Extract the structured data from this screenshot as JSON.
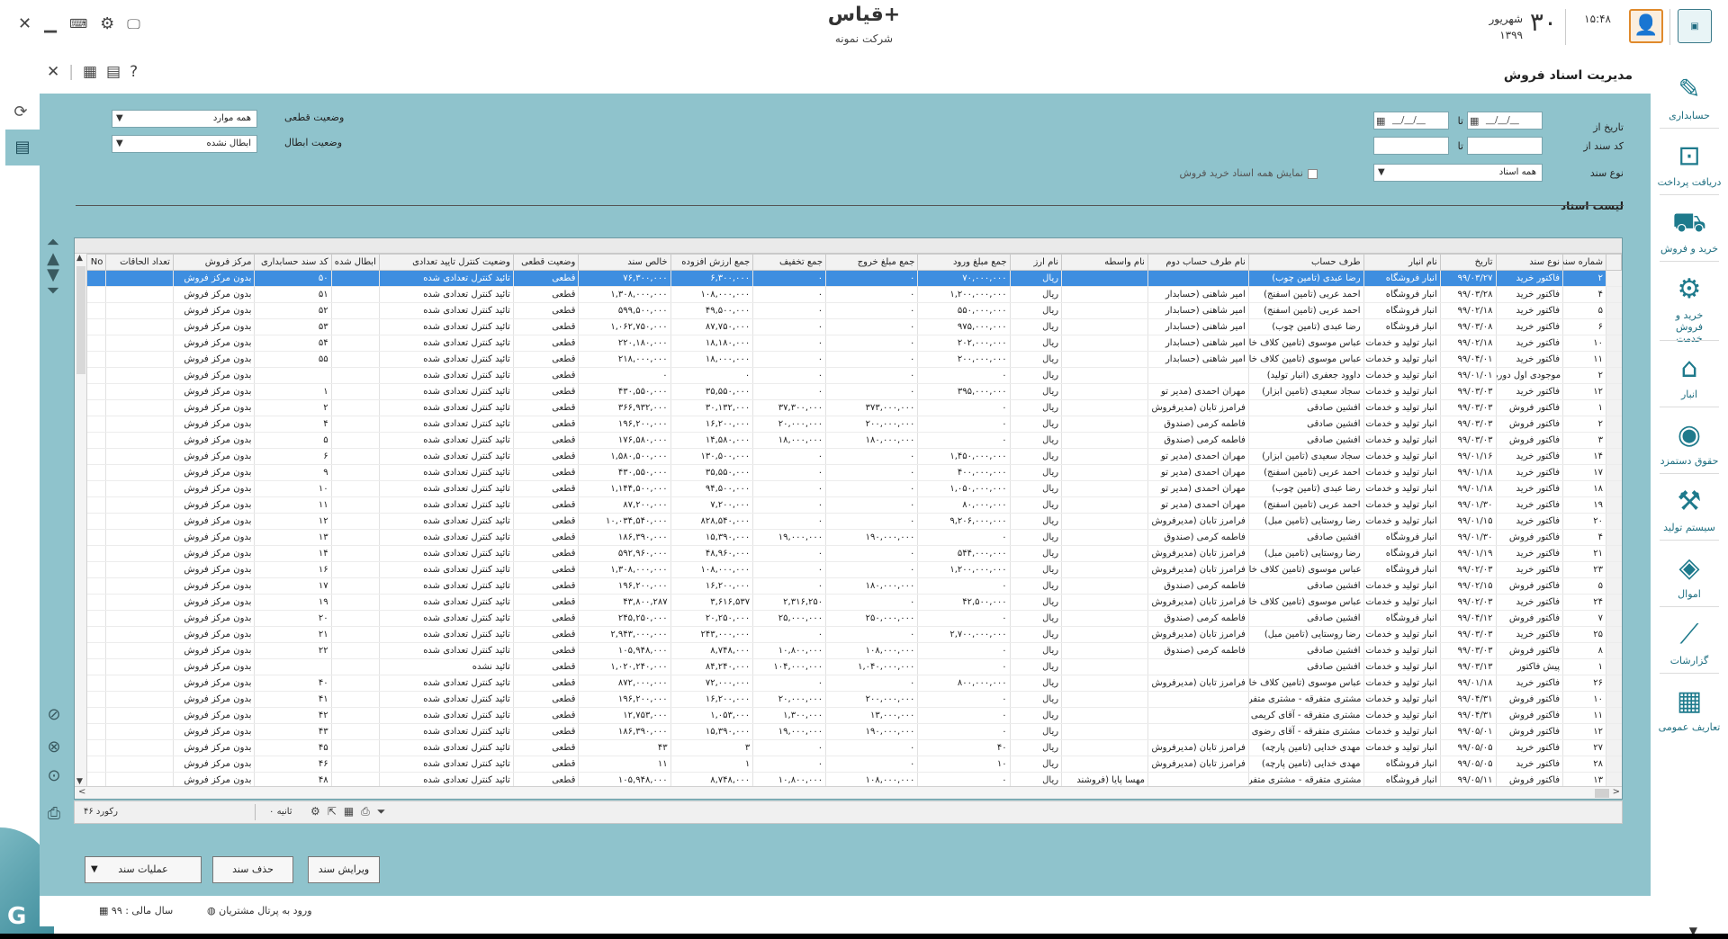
{
  "app": {
    "name": "قیاس+",
    "company": "شرکت نمونه"
  },
  "clock": {
    "time": "۱۵:۴۸",
    "day": "۳۰",
    "month": "شهریور",
    "year": "۱۳۹۹"
  },
  "page_title": "مدیریت اسناد فروش",
  "filters": {
    "date_from_label": "تاریخ از",
    "to_label": "تا",
    "date_placeholder": "__/__/__",
    "doc_code_label": "کد سند از",
    "doc_type_label": "نوع سند",
    "doc_type_value": "همه اسناد",
    "show_all_label": "نمایش همه اسناد خرید فروش",
    "final_status_label": "وضعیت قطعی",
    "final_status_value": "همه موارد",
    "cancel_status_label": "وضعیت ابطال",
    "cancel_status_value": "ابطال نشده"
  },
  "list_title": "لیست اسناد",
  "columns": [
    "شماره سند",
    "نوع سند",
    "تاریخ",
    "نام انبار",
    "طرف حساب",
    "نام طرف حساب دوم",
    "نام واسطه",
    "نام ارز",
    "جمع مبلغ ورود",
    "جمع مبلغ خروج",
    "جمع تخفیف",
    "جمع ارزش افزوده",
    "خالص سند",
    "وضعیت قطعی",
    "وضعیت کنترل تایید تعدادی",
    "ابطال شده",
    "کد سند حسابداری",
    "مرکز فروش",
    "تعداد الحاقات",
    "No"
  ],
  "rows": [
    [
      "۲",
      "فاکتور خرید",
      "۹۹/۰۳/۲۷",
      "انبار فروشگاه",
      "رضا عبدی (تامین چوب)",
      "",
      "",
      "ریال",
      "۷۰,۰۰۰,۰۰۰",
      "۰",
      "۰",
      "۶,۳۰۰,۰۰۰",
      "۷۶,۳۰۰,۰۰۰",
      "قطعی",
      "تائید کنترل تعدادی شده",
      "",
      "۵۰",
      "بدون مرکز فروش",
      "",
      ""
    ],
    [
      "۴",
      "فاکتور خرید",
      "۹۹/۰۳/۲۸",
      "انبار فروشگاه",
      "احمد عربی (تامین اسفنج)",
      "امیر شاهنی (حسابدار",
      "",
      "ریال",
      "۱,۲۰۰,۰۰۰,۰۰۰",
      "۰",
      "۰",
      "۱۰۸,۰۰۰,۰۰۰",
      "۱,۳۰۸,۰۰۰,۰۰۰",
      "قطعی",
      "تائید کنترل تعدادی شده",
      "",
      "۵۱",
      "بدون مرکز فروش",
      "",
      ""
    ],
    [
      "۵",
      "فاکتور خرید",
      "۹۹/۰۲/۱۸",
      "انبار فروشگاه",
      "احمد عربی (تامین اسفنج)",
      "امیر شاهنی (حسابدار",
      "",
      "ریال",
      "۵۵۰,۰۰۰,۰۰۰",
      "۰",
      "۰",
      "۴۹,۵۰۰,۰۰۰",
      "۵۹۹,۵۰۰,۰۰۰",
      "قطعی",
      "تائید کنترل تعدادی شده",
      "",
      "۵۲",
      "بدون مرکز فروش",
      "",
      ""
    ],
    [
      "۶",
      "فاکتور خرید",
      "۹۹/۰۳/۰۸",
      "انبار فروشگاه",
      "رضا عبدی (تامین چوب)",
      "امیر شاهنی (حسابدار",
      "",
      "ریال",
      "۹۷۵,۰۰۰,۰۰۰",
      "۰",
      "۰",
      "۸۷,۷۵۰,۰۰۰",
      "۱,۰۶۲,۷۵۰,۰۰۰",
      "قطعی",
      "تائید کنترل تعدادی شده",
      "",
      "۵۳",
      "بدون مرکز فروش",
      "",
      ""
    ],
    [
      "۱۰",
      "فاکتور خرید",
      "۹۹/۰۲/۱۸",
      "انبار تولید و خدمات",
      "عباس موسوی (تامین کلاف خام)",
      "امیر شاهنی (حسابدار",
      "",
      "ریال",
      "۲۰۲,۰۰۰,۰۰۰",
      "۰",
      "۰",
      "۱۸,۱۸۰,۰۰۰",
      "۲۲۰,۱۸۰,۰۰۰",
      "قطعی",
      "تائید کنترل تعدادی شده",
      "",
      "۵۴",
      "بدون مرکز فروش",
      "",
      ""
    ],
    [
      "۱۱",
      "فاکتور خرید",
      "۹۹/۰۴/۰۱",
      "انبار تولید و خدمات",
      "عباس موسوی (تامین کلاف خام)",
      "امیر شاهنی (حسابدار",
      "",
      "ریال",
      "۲۰۰,۰۰۰,۰۰۰",
      "۰",
      "۰",
      "۱۸,۰۰۰,۰۰۰",
      "۲۱۸,۰۰۰,۰۰۰",
      "قطعی",
      "تائید کنترل تعدادی شده",
      "",
      "۵۵",
      "بدون مرکز فروش",
      "",
      ""
    ],
    [
      "۲",
      "موجودی اول دوره",
      "۹۹/۰۱/۰۱",
      "انبار تولید و خدمات",
      "داوود جعفری (انبار تولید)",
      "",
      "",
      "ریال",
      "۰",
      "۰",
      "۰",
      "۰",
      "۰",
      "قطعی",
      "تائید کنترل تعدادی شده",
      "",
      "",
      "بدون مرکز فروش",
      "",
      ""
    ],
    [
      "۱۲",
      "فاکتور خرید",
      "۹۹/۰۳/۰۳",
      "انبار تولید و خدمات",
      "سجاد سعیدی (تامین ابزار)",
      "مهران احمدی (مدیر تو",
      "",
      "ریال",
      "۳۹۵,۰۰۰,۰۰۰",
      "۰",
      "۰",
      "۳۵,۵۵۰,۰۰۰",
      "۴۳۰,۵۵۰,۰۰۰",
      "قطعی",
      "تائید کنترل تعدادی شده",
      "",
      "۱",
      "بدون مرکز فروش",
      "",
      ""
    ],
    [
      "۱",
      "فاکتور فروش",
      "۹۹/۰۳/۰۳",
      "انبار تولید و خدمات",
      "افشین صادقی",
      "فرامرز تابان (مدیرفروش",
      "",
      "ریال",
      "۰",
      "۳۷۳,۰۰۰,۰۰۰",
      "۳۷,۳۰۰,۰۰۰",
      "۳۰,۱۳۲,۰۰۰",
      "۳۶۶,۹۳۲,۰۰۰",
      "قطعی",
      "تائید کنترل تعدادی شده",
      "",
      "۲",
      "بدون مرکز فروش",
      "",
      ""
    ],
    [
      "۲",
      "فاکتور فروش",
      "۹۹/۰۳/۰۳",
      "انبار تولید و خدمات",
      "افشین صادقی",
      "فاطمه کرمی (صندوق",
      "",
      "ریال",
      "۰",
      "۲۰۰,۰۰۰,۰۰۰",
      "۲۰,۰۰۰,۰۰۰",
      "۱۶,۲۰۰,۰۰۰",
      "۱۹۶,۲۰۰,۰۰۰",
      "قطعی",
      "تائید کنترل تعدادی شده",
      "",
      "۴",
      "بدون مرکز فروش",
      "",
      ""
    ],
    [
      "۳",
      "فاکتور فروش",
      "۹۹/۰۳/۰۳",
      "انبار تولید و خدمات",
      "افشین صادقی",
      "فاطمه کرمی (صندوق",
      "",
      "ریال",
      "۰",
      "۱۸۰,۰۰۰,۰۰۰",
      "۱۸,۰۰۰,۰۰۰",
      "۱۴,۵۸۰,۰۰۰",
      "۱۷۶,۵۸۰,۰۰۰",
      "قطعی",
      "تائید کنترل تعدادی شده",
      "",
      "۵",
      "بدون مرکز فروش",
      "",
      ""
    ],
    [
      "۱۴",
      "فاکتور خرید",
      "۹۹/۰۱/۱۶",
      "انبار تولید و خدمات",
      "سجاد سعیدی (تامین ابزار)",
      "مهران احمدی (مدیر تو",
      "",
      "ریال",
      "۱,۴۵۰,۰۰۰,۰۰۰",
      "۰",
      "۰",
      "۱۳۰,۵۰۰,۰۰۰",
      "۱,۵۸۰,۵۰۰,۰۰۰",
      "قطعی",
      "تائید کنترل تعدادی شده",
      "",
      "۶",
      "بدون مرکز فروش",
      "",
      ""
    ],
    [
      "۱۷",
      "فاکتور خرید",
      "۹۹/۰۱/۱۸",
      "انبار تولید و خدمات",
      "احمد عربی (تامین اسفنج)",
      "مهران احمدی (مدیر تو",
      "",
      "ریال",
      "۴۰۰,۰۰۰,۰۰۰",
      "۰",
      "۰",
      "۳۵,۵۵۰,۰۰۰",
      "۴۳۰,۵۵۰,۰۰۰",
      "قطعی",
      "تائید کنترل تعدادی شده",
      "",
      "۹",
      "بدون مرکز فروش",
      "",
      ""
    ],
    [
      "۱۸",
      "فاکتور خرید",
      "۹۹/۰۱/۱۸",
      "انبار تولید و خدمات",
      "رضا عبدی (تامین چوب)",
      "مهران احمدی (مدیر تو",
      "",
      "ریال",
      "۱,۰۵۰,۰۰۰,۰۰۰",
      "۰",
      "۰",
      "۹۴,۵۰۰,۰۰۰",
      "۱,۱۴۴,۵۰۰,۰۰۰",
      "قطعی",
      "تائید کنترل تعدادی شده",
      "",
      "۱۰",
      "بدون مرکز فروش",
      "",
      ""
    ],
    [
      "۱۹",
      "فاکتور خرید",
      "۹۹/۰۱/۳۰",
      "انبار تولید و خدمات",
      "احمد عربی (تامین اسفنج)",
      "مهران احمدی (مدیر تو",
      "",
      "ریال",
      "۸۰,۰۰۰,۰۰۰",
      "۰",
      "۰",
      "۷,۲۰۰,۰۰۰",
      "۸۷,۲۰۰,۰۰۰",
      "قطعی",
      "تائید کنترل تعدادی شده",
      "",
      "۱۱",
      "بدون مرکز فروش",
      "",
      ""
    ],
    [
      "۲۰",
      "فاکتور خرید",
      "۹۹/۰۱/۱۵",
      "انبار تولید و خدمات",
      "رضا روستایی (تامین مبل)",
      "فرامرز تابان (مدیرفروش",
      "",
      "ریال",
      "۹,۲۰۶,۰۰۰,۰۰۰",
      "۰",
      "۰",
      "۸۲۸,۵۴۰,۰۰۰",
      "۱۰,۰۳۴,۵۴۰,۰۰۰",
      "قطعی",
      "تائید کنترل تعدادی شده",
      "",
      "۱۲",
      "بدون مرکز فروش",
      "",
      ""
    ],
    [
      "۴",
      "فاکتور فروش",
      "۹۹/۰۱/۳۰",
      "انبار فروشگاه",
      "افشین صادقی",
      "فاطمه کرمی (صندوق",
      "",
      "ریال",
      "۰",
      "۱۹۰,۰۰۰,۰۰۰",
      "۱۹,۰۰۰,۰۰۰",
      "۱۵,۳۹۰,۰۰۰",
      "۱۸۶,۳۹۰,۰۰۰",
      "قطعی",
      "تائید کنترل تعدادی شده",
      "",
      "۱۳",
      "بدون مرکز فروش",
      "",
      ""
    ],
    [
      "۲۱",
      "فاکتور خرید",
      "۹۹/۰۱/۱۹",
      "انبار فروشگاه",
      "رضا روستایی (تامین مبل)",
      "فرامرز تابان (مدیرفروش",
      "",
      "ریال",
      "۵۴۴,۰۰۰,۰۰۰",
      "۰",
      "۰",
      "۴۸,۹۶۰,۰۰۰",
      "۵۹۲,۹۶۰,۰۰۰",
      "قطعی",
      "تائید کنترل تعدادی شده",
      "",
      "۱۴",
      "بدون مرکز فروش",
      "",
      ""
    ],
    [
      "۲۳",
      "فاکتور خرید",
      "۹۹/۰۲/۰۳",
      "انبار فروشگاه",
      "عباس موسوی (تامین کلاف خام)",
      "فرامرز تابان (مدیرفروش",
      "",
      "ریال",
      "۱,۲۰۰,۰۰۰,۰۰۰",
      "۰",
      "۰",
      "۱۰۸,۰۰۰,۰۰۰",
      "۱,۳۰۸,۰۰۰,۰۰۰",
      "قطعی",
      "تائید کنترل تعدادی شده",
      "",
      "۱۶",
      "بدون مرکز فروش",
      "",
      ""
    ],
    [
      "۵",
      "فاکتور فروش",
      "۹۹/۰۲/۱۵",
      "انبار تولید و خدمات",
      "افشین صادقی",
      "فاطمه کرمی (صندوق",
      "",
      "ریال",
      "۰",
      "۱۸۰,۰۰۰,۰۰۰",
      "۰",
      "۱۶,۲۰۰,۰۰۰",
      "۱۹۶,۲۰۰,۰۰۰",
      "قطعی",
      "تائید کنترل تعدادی شده",
      "",
      "۱۷",
      "بدون مرکز فروش",
      "",
      ""
    ],
    [
      "۲۴",
      "فاکتور خرید",
      "۹۹/۰۲/۰۳",
      "انبار تولید و خدمات",
      "عباس موسوی (تامین کلاف خام)",
      "فرامرز تابان (مدیرفروش",
      "",
      "ریال",
      "۴۲,۵۰۰,۰۰۰",
      "۰",
      "۲,۳۱۶,۲۵۰",
      "۳,۶۱۶,۵۳۷",
      "۴۳,۸۰۰,۲۸۷",
      "قطعی",
      "تائید کنترل تعدادی شده",
      "",
      "۱۹",
      "بدون مرکز فروش",
      "",
      ""
    ],
    [
      "۷",
      "فاکتور فروش",
      "۹۹/۰۴/۱۲",
      "انبار فروشگاه",
      "افشین صادقی",
      "فاطمه کرمی (صندوق",
      "",
      "ریال",
      "۰",
      "۲۵۰,۰۰۰,۰۰۰",
      "۲۵,۰۰۰,۰۰۰",
      "۲۰,۲۵۰,۰۰۰",
      "۲۴۵,۲۵۰,۰۰۰",
      "قطعی",
      "تائید کنترل تعدادی شده",
      "",
      "۲۰",
      "بدون مرکز فروش",
      "",
      ""
    ],
    [
      "۲۵",
      "فاکتور خرید",
      "۹۹/۰۳/۰۳",
      "انبار تولید و خدمات",
      "رضا روستایی (تامین مبل)",
      "فرامرز تابان (مدیرفروش",
      "",
      "ریال",
      "۲,۷۰۰,۰۰۰,۰۰۰",
      "۰",
      "۰",
      "۲۴۳,۰۰۰,۰۰۰",
      "۲,۹۴۳,۰۰۰,۰۰۰",
      "قطعی",
      "تائید کنترل تعدادی شده",
      "",
      "۲۱",
      "بدون مرکز فروش",
      "",
      ""
    ],
    [
      "۸",
      "فاکتور فروش",
      "۹۹/۰۳/۰۳",
      "انبار تولید و خدمات",
      "افشین صادقی",
      "فاطمه کرمی (صندوق",
      "",
      "ریال",
      "۰",
      "۱۰۸,۰۰۰,۰۰۰",
      "۱۰,۸۰۰,۰۰۰",
      "۸,۷۴۸,۰۰۰",
      "۱۰۵,۹۴۸,۰۰۰",
      "قطعی",
      "تائید کنترل تعدادی شده",
      "",
      "۲۲",
      "بدون مرکز فروش",
      "",
      ""
    ],
    [
      "۱",
      "پیش فاکتور",
      "۹۹/۰۳/۱۳",
      "انبار تولید و خدمات",
      "افشین صادقی",
      "",
      "",
      "ریال",
      "۰",
      "۱,۰۴۰,۰۰۰,۰۰۰",
      "۱۰۴,۰۰۰,۰۰۰",
      "۸۴,۲۴۰,۰۰۰",
      "۱,۰۲۰,۲۴۰,۰۰۰",
      "قطعی",
      "تائید نشده",
      "",
      "",
      "بدون مرکز فروش",
      "",
      ""
    ],
    [
      "۲۶",
      "فاکتور خرید",
      "۹۹/۰۱/۱۸",
      "انبار تولید و خدمات",
      "عباس موسوی (تامین کلاف خام)",
      "فرامرز تابان (مدیرفروش",
      "",
      "ریال",
      "۸۰۰,۰۰۰,۰۰۰",
      "۰",
      "۰",
      "۷۲,۰۰۰,۰۰۰",
      "۸۷۲,۰۰۰,۰۰۰",
      "قطعی",
      "تائید کنترل تعدادی شده",
      "",
      "۴۰",
      "بدون مرکز فروش",
      "",
      ""
    ],
    [
      "۱۰",
      "فاکتور فروش",
      "۹۹/۰۴/۳۱",
      "انبار تولید و خدمات",
      "مشتری متفرقه - مشتری متفرقه",
      "",
      "",
      "ریال",
      "۰",
      "۲۰۰,۰۰۰,۰۰۰",
      "۲۰,۰۰۰,۰۰۰",
      "۱۶,۲۰۰,۰۰۰",
      "۱۹۶,۲۰۰,۰۰۰",
      "قطعی",
      "تائید کنترل تعدادی شده",
      "",
      "۴۱",
      "بدون مرکز فروش",
      "",
      ""
    ],
    [
      "۱۱",
      "فاکتور فروش",
      "۹۹/۰۴/۳۱",
      "انبار تولید و خدمات",
      "مشتری متفرقه - آقای کریمی",
      "",
      "",
      "ریال",
      "۰",
      "۱۳,۰۰۰,۰۰۰",
      "۱,۳۰۰,۰۰۰",
      "۱,۰۵۳,۰۰۰",
      "۱۲,۷۵۳,۰۰۰",
      "قطعی",
      "تائید کنترل تعدادی شده",
      "",
      "۴۲",
      "بدون مرکز فروش",
      "",
      ""
    ],
    [
      "۱۲",
      "فاکتور فروش",
      "۹۹/۰۵/۰۱",
      "انبار تولید و خدمات",
      "مشتری متفرقه - آقای رضوی",
      "",
      "",
      "ریال",
      "۰",
      "۱۹۰,۰۰۰,۰۰۰",
      "۱۹,۰۰۰,۰۰۰",
      "۱۵,۳۹۰,۰۰۰",
      "۱۸۶,۳۹۰,۰۰۰",
      "قطعی",
      "تائید کنترل تعدادی شده",
      "",
      "۴۳",
      "بدون مرکز فروش",
      "",
      ""
    ],
    [
      "۲۷",
      "فاکتور خرید",
      "۹۹/۰۵/۰۵",
      "انبار تولید و خدمات",
      "مهدی خدایی (تامین پارچه)",
      "فرامرز تابان (مدیرفروش",
      "",
      "ریال",
      "۴۰",
      "۰",
      "۰",
      "۳",
      "۴۳",
      "قطعی",
      "تائید کنترل تعدادی شده",
      "",
      "۴۵",
      "بدون مرکز فروش",
      "",
      ""
    ],
    [
      "۲۸",
      "فاکتور خرید",
      "۹۹/۰۵/۰۵",
      "انبار فروشگاه",
      "مهدی خدایی (تامین پارچه)",
      "فرامرز تابان (مدیرفروش",
      "",
      "ریال",
      "۱۰",
      "۰",
      "۰",
      "۱",
      "۱۱",
      "قطعی",
      "تائید کنترل تعدادی شده",
      "",
      "۴۶",
      "بدون مرکز فروش",
      "",
      ""
    ],
    [
      "۱۳",
      "فاکتور فروش",
      "۹۹/۰۵/۱۱",
      "انبار فروشگاه",
      "مشتری متفرقه - مشتری متفرقه",
      "",
      "مهسا پایا (فروشند",
      "ریال",
      "۰",
      "۱۰۸,۰۰۰,۰۰۰",
      "۱۰,۸۰۰,۰۰۰",
      "۸,۷۴۸,۰۰۰",
      "۱۰۵,۹۴۸,۰۰۰",
      "قطعی",
      "تائید کنترل تعدادی شده",
      "",
      "۴۸",
      "بدون مرکز فروش",
      "",
      ""
    ]
  ],
  "selected_row": 0,
  "footer": {
    "records": "۴۶ رکورد",
    "seconds": "۰ ثانیه"
  },
  "buttons": {
    "edit": "ویرایش سند",
    "delete": "حذف سند",
    "ops": "عملیات سند"
  },
  "nav": [
    {
      "label": "حسابداری",
      "icon": "accounting-icon"
    },
    {
      "label": "دریافت پرداخت",
      "icon": "payment-icon"
    },
    {
      "label": "خرید و فروش",
      "icon": "cart-icon"
    },
    {
      "label": "خرید و فروش خدمت",
      "icon": "service-gear-icon"
    },
    {
      "label": "انبار",
      "icon": "warehouse-icon"
    },
    {
      "label": "حقوق دستمزد",
      "icon": "payroll-icon"
    },
    {
      "label": "سیستم تولید",
      "icon": "production-icon"
    },
    {
      "label": "اموال",
      "icon": "assets-icon"
    },
    {
      "label": "گزارشات",
      "icon": "reports-icon"
    },
    {
      "label": "تعاریف عمومی",
      "icon": "definitions-icon"
    }
  ],
  "status": {
    "fiscal_year": "سال مالی : ۹۹",
    "portal": "ورود به پرتال مشتریان"
  },
  "colors": {
    "accent": "#8fc3cc",
    "selected_row": "#3e8ee0",
    "nav_text": "#1e6e80"
  }
}
